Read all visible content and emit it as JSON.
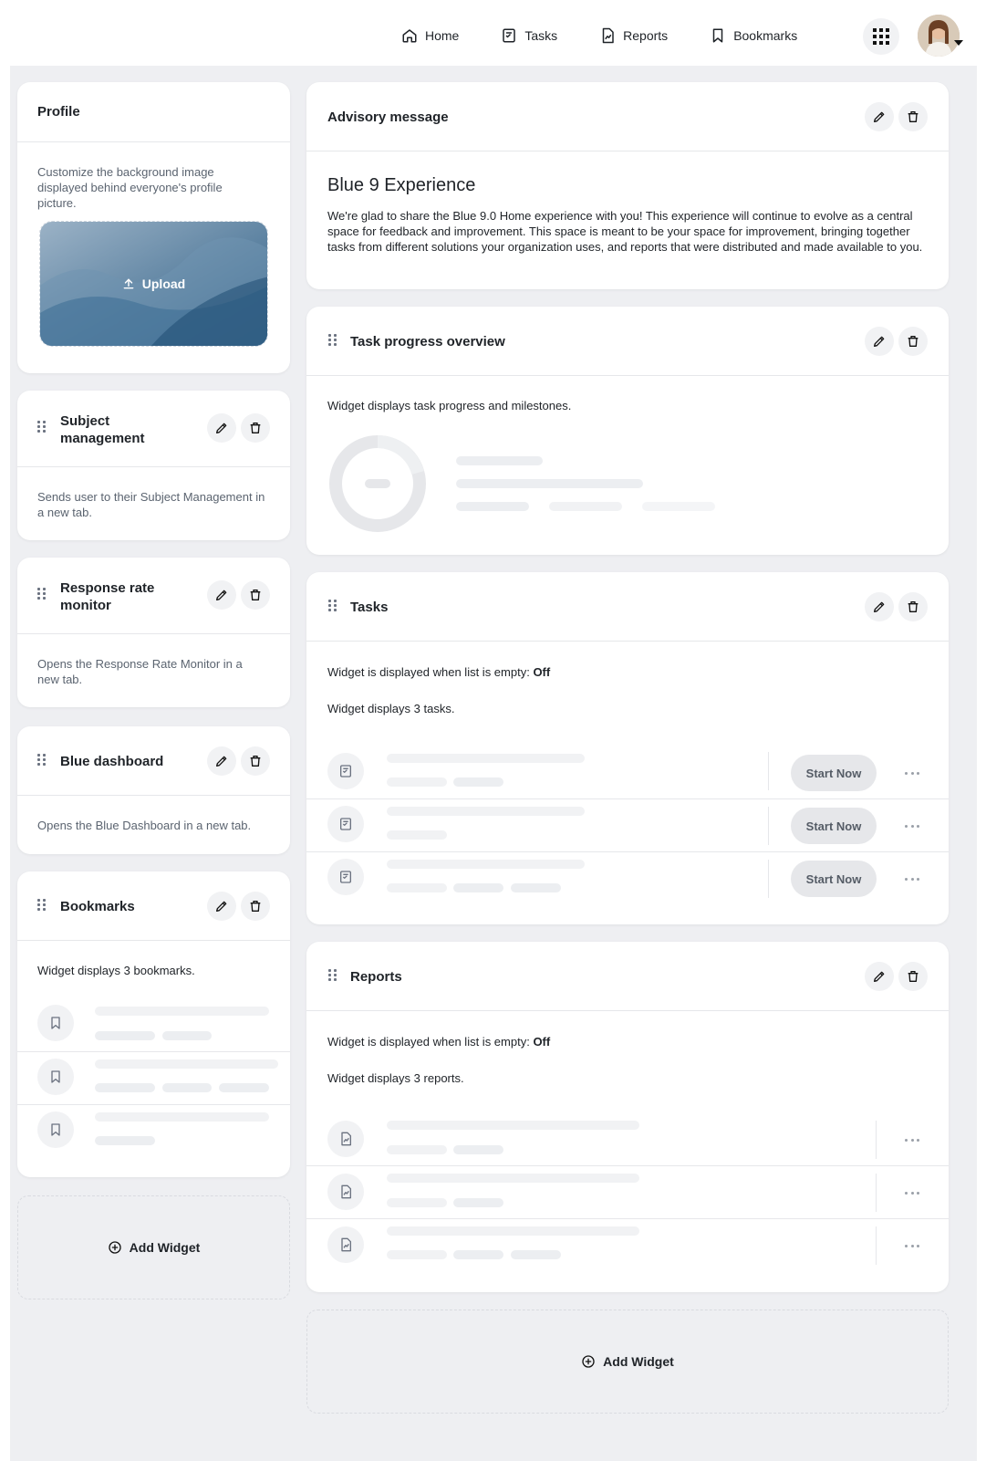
{
  "nav": {
    "items": [
      {
        "label": "Home",
        "icon": "home-icon"
      },
      {
        "label": "Tasks",
        "icon": "tasks-icon"
      },
      {
        "label": "Reports",
        "icon": "reports-icon"
      },
      {
        "label": "Bookmarks",
        "icon": "bookmark-icon"
      }
    ]
  },
  "profile": {
    "title": "Profile",
    "description": "Customize the background image displayed behind everyone's profile picture.",
    "upload_label": "Upload"
  },
  "subject_management": {
    "title_line1": "Subject",
    "title_line2": "management",
    "description": "Sends user to their Subject Management in a new tab."
  },
  "response_rate": {
    "title_line1": "Response rate",
    "title_line2": "monitor",
    "description": "Opens the Response Rate Monitor in a new tab."
  },
  "blue_dashboard": {
    "title": "Blue dashboard",
    "description": "Opens the Blue Dashboard in a new tab."
  },
  "bookmarks": {
    "title": "Bookmarks",
    "displays_prefix": "Widget displays",
    "count": "3",
    "displays_suffix": "bookmarks."
  },
  "add_widget_label": "Add Widget",
  "advisory": {
    "title": "Advisory message",
    "heading": "Blue 9 Experience",
    "body": "We're glad to share the Blue 9.0 Home experience with you! This experience will continue to evolve as a central space for feedback and improvement. This space is meant to be your space for improvement, bringing together tasks from different solutions your organization uses, and reports that were distributed and made available to you."
  },
  "task_progress": {
    "title": "Task progress overview",
    "description": "Widget displays task progress and milestones."
  },
  "tasks": {
    "title": "Tasks",
    "empty_prefix": "Widget is displayed when list is empty:",
    "empty_value": "Off",
    "displays_prefix": "Widget displays",
    "count": "3",
    "displays_suffix": "tasks.",
    "start_label": "Start Now"
  },
  "reports": {
    "title": "Reports",
    "empty_prefix": "Widget is displayed when list is empty:",
    "empty_value": "Off",
    "displays_prefix": "Widget displays",
    "count": "3",
    "displays_suffix": "reports."
  }
}
